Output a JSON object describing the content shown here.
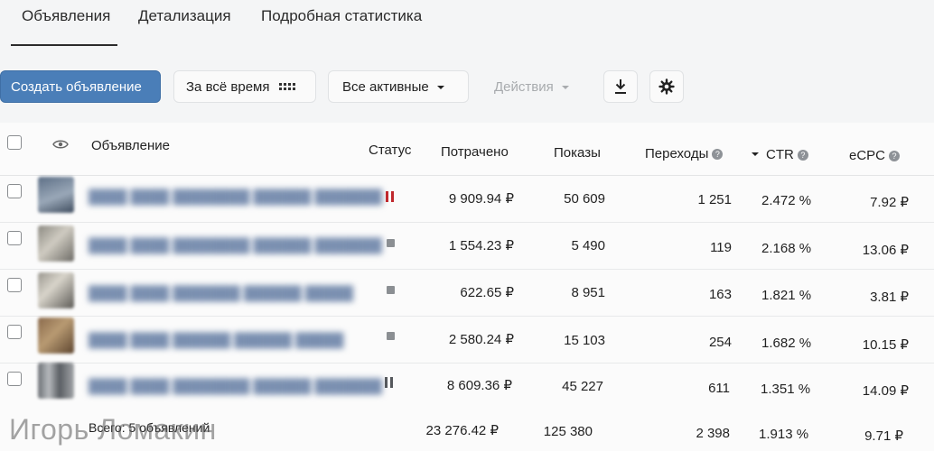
{
  "tabs": [
    {
      "label": "Объявления",
      "active": true
    },
    {
      "label": "Детализация",
      "active": false
    },
    {
      "label": "Подробная статистика",
      "active": false
    }
  ],
  "toolbar": {
    "create_label": "Создать объявление",
    "period_label": "За всё время",
    "filter_label": "Все активные",
    "actions_label": "Действия",
    "download_icon": "download-icon",
    "settings_icon": "gear-icon"
  },
  "table": {
    "headers": {
      "ad": "Объявление",
      "status": "Статус",
      "spent": "Потрачено",
      "impressions": "Показы",
      "clicks": "Переходы",
      "ctr": "CTR",
      "ecpc": "eCPC"
    },
    "sort": {
      "column": "ctr",
      "direction": "desc"
    },
    "rows": [
      {
        "status": "paused-red",
        "spent": "9 909.94 ₽",
        "impressions": "50 609",
        "clicks": "1 251",
        "ctr": "2.472 %",
        "ecpc": "7.92 ₽"
      },
      {
        "status": "stopped",
        "spent": "1 554.23 ₽",
        "impressions": "5 490",
        "clicks": "119",
        "ctr": "2.168 %",
        "ecpc": "13.06 ₽"
      },
      {
        "status": "stopped",
        "spent": "622.65 ₽",
        "impressions": "8 951",
        "clicks": "163",
        "ctr": "1.821 %",
        "ecpc": "3.81 ₽"
      },
      {
        "status": "stopped",
        "spent": "2 580.24 ₽",
        "impressions": "15 103",
        "clicks": "254",
        "ctr": "1.682 %",
        "ecpc": "10.15 ₽"
      },
      {
        "status": "paused",
        "spent": "8 609.36 ₽",
        "impressions": "45 227",
        "clicks": "611",
        "ctr": "1.351 %",
        "ecpc": "14.09 ₽"
      }
    ],
    "footer": {
      "label": "Всего: 5 объявлений",
      "spent": "23 276.42 ₽",
      "impressions": "125 380",
      "clicks": "2 398",
      "ctr": "1.913 %",
      "ecpc": "9.71 ₽"
    }
  },
  "colors": {
    "accent": "#4a7eb8",
    "pause_red": "#c0282d",
    "neutral_status": "#8b8f93"
  },
  "watermark": "Игорь Ломакин"
}
